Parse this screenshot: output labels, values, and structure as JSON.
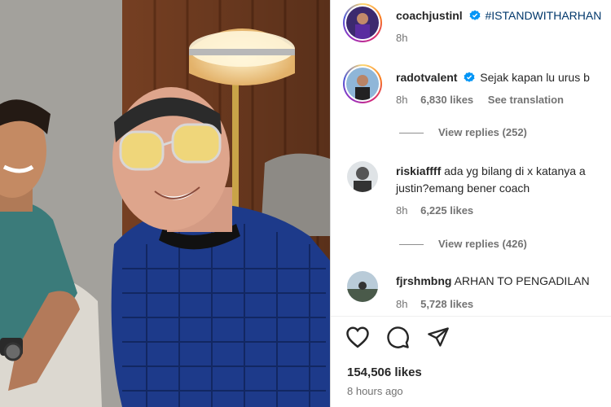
{
  "post": {
    "author": "coachjustinl",
    "caption": "#ISTANDWITHARHAN",
    "time": "8h"
  },
  "comments": [
    {
      "username": "radotvalent",
      "verified": true,
      "text": "Sejak kapan lu urus b",
      "time": "8h",
      "likes": "6,830 likes",
      "translate": "See translation",
      "replies": "View replies (252)"
    },
    {
      "username": "riskiaffff",
      "verified": false,
      "text_line1": "ada yg bilang di x katanya a",
      "text_line2": "justin?emang bener coach",
      "time": "8h",
      "likes": "6,225 likes",
      "replies": "View replies (426)"
    },
    {
      "username": "fjrshmbng",
      "verified": false,
      "text": "ARHAN TO PENGADILAN",
      "time": "8h",
      "likes": "5,728 likes"
    }
  ],
  "actions": {
    "like_icon": "heart-icon",
    "comment_icon": "comment-icon",
    "share_icon": "paper-plane-icon"
  },
  "summary": {
    "likes": "154,506 likes",
    "posted": "8 hours ago"
  },
  "colors": {
    "verified": "#0095f6",
    "text": "#262626",
    "secondary": "#737373"
  }
}
